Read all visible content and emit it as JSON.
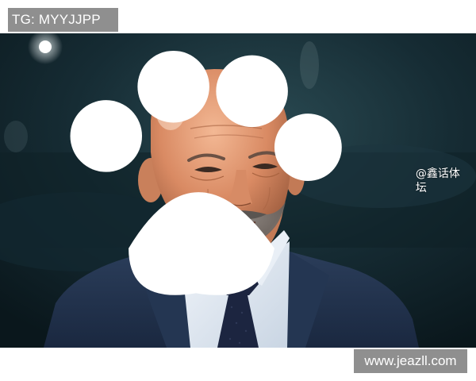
{
  "watermark_top": "TG: MYYJJPP",
  "photo": {
    "alt": "",
    "caption": "@鑫话体坛",
    "caption_icon": "paw-icon"
  },
  "watermark_bottom": "www.jeazll.com"
}
